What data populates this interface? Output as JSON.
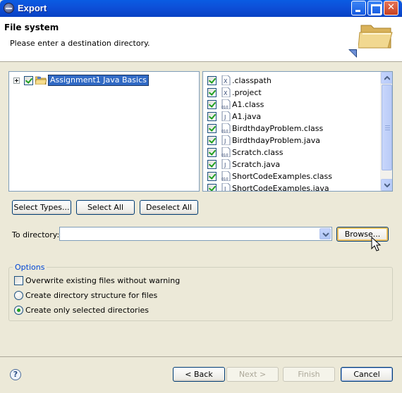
{
  "window": {
    "title": "Export",
    "controls": [
      "minimize",
      "maximize",
      "close"
    ]
  },
  "header": {
    "title": "File system",
    "message": "Please enter a destination directory."
  },
  "tree": {
    "items": [
      {
        "label": "Assignment1 Java Basics",
        "checked": true,
        "expanded": false,
        "selected": true,
        "icon": "project-folder-icon"
      }
    ]
  },
  "files": {
    "items": [
      {
        "label": ".classpath",
        "checked": true,
        "icon": "xml-file-icon"
      },
      {
        "label": ".project",
        "checked": true,
        "icon": "xml-file-icon"
      },
      {
        "label": "A1.class",
        "checked": true,
        "icon": "class-file-icon"
      },
      {
        "label": "A1.java",
        "checked": true,
        "icon": "java-file-icon"
      },
      {
        "label": "BirdthdayProblem.class",
        "checked": true,
        "icon": "class-file-icon"
      },
      {
        "label": "BirdthdayProblem.java",
        "checked": true,
        "icon": "java-file-icon"
      },
      {
        "label": "Scratch.class",
        "checked": true,
        "icon": "class-file-icon"
      },
      {
        "label": "Scratch.java",
        "checked": true,
        "icon": "java-file-icon"
      },
      {
        "label": "ShortCodeExamples.class",
        "checked": true,
        "icon": "class-file-icon"
      },
      {
        "label": "ShortCodeExamples.java",
        "checked": true,
        "icon": "java-file-icon"
      }
    ]
  },
  "selection_buttons": {
    "select_types": "Select Types...",
    "select_all": "Select All",
    "deselect_all": "Deselect All"
  },
  "destination": {
    "label": "To directory:",
    "value": "",
    "browse": "Browse..."
  },
  "options": {
    "title": "Options",
    "overwrite": {
      "label": "Overwrite existing files without warning",
      "checked": false
    },
    "create_structure": {
      "label": "Create directory structure for files",
      "selected": false
    },
    "create_selected": {
      "label": "Create only selected directories",
      "selected": true
    }
  },
  "footer": {
    "back": "< Back",
    "next": "Next >",
    "finish": "Finish",
    "cancel": "Cancel"
  }
}
